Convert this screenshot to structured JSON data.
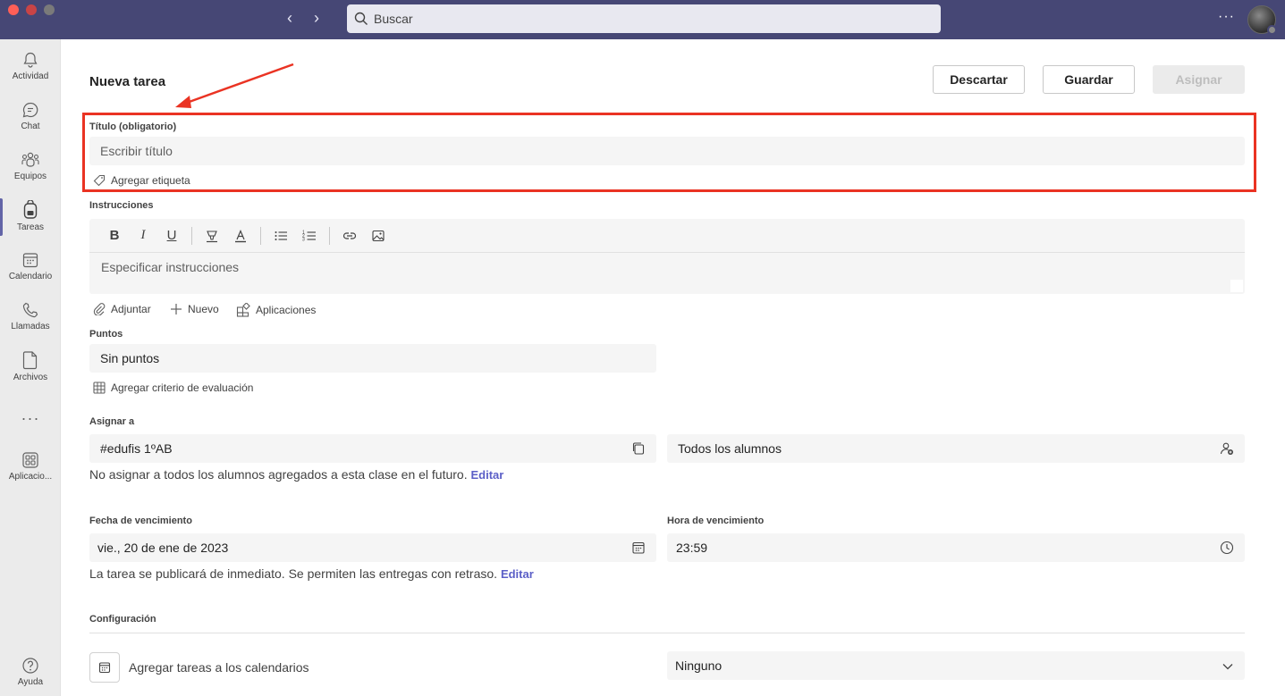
{
  "topbar": {
    "search_placeholder": "Buscar",
    "nav_back": "‹",
    "nav_forward": "›",
    "more": "···"
  },
  "rail": {
    "items": [
      {
        "label": "Actividad",
        "icon": "bell-icon"
      },
      {
        "label": "Chat",
        "icon": "chat-icon"
      },
      {
        "label": "Equipos",
        "icon": "teams-icon"
      },
      {
        "label": "Tareas",
        "icon": "backpack-icon",
        "active": true
      },
      {
        "label": "Calendario",
        "icon": "calendar-icon"
      },
      {
        "label": "Llamadas",
        "icon": "phone-icon"
      },
      {
        "label": "Archivos",
        "icon": "file-icon"
      },
      {
        "label": "Aplicacio...",
        "icon": "apps-icon"
      },
      {
        "label": "Ayuda",
        "icon": "help-icon"
      }
    ],
    "more": "···"
  },
  "header": {
    "title": "Nueva tarea",
    "discard_label": "Descartar",
    "save_label": "Guardar",
    "assign_label": "Asignar"
  },
  "title_field": {
    "label": "Título (obligatorio)",
    "placeholder": "Escribir título",
    "add_tag": "Agregar etiqueta"
  },
  "instructions": {
    "label": "Instrucciones",
    "placeholder": "Especificar instrucciones",
    "toolbar": {
      "bold": "B",
      "italic": "I",
      "underline": "U"
    },
    "attach": "Adjuntar",
    "new": "Nuevo",
    "apps": "Aplicaciones"
  },
  "points": {
    "label": "Puntos",
    "value": "Sin puntos",
    "add_rubric": "Agregar criterio de evaluación"
  },
  "assign_to": {
    "label": "Asignar a",
    "class_value": "#edufis 1ºAB",
    "students_value": "Todos los alumnos",
    "note": "No asignar a todos los alumnos agregados a esta clase en el futuro.",
    "edit": "Editar"
  },
  "due": {
    "date_label": "Fecha de vencimiento",
    "date_value": "vie., 20 de ene de 2023",
    "time_label": "Hora de vencimiento",
    "time_value": "23:59",
    "note": "La tarea se publicará de inmediato. Se permiten las entregas con retraso.",
    "edit": "Editar"
  },
  "settings": {
    "label": "Configuración",
    "calendar_label": "Agregar tareas a los calendarios",
    "calendar_value": "Ninguno"
  },
  "colors": {
    "titlebar": "#464775",
    "accent": "#5b5fc7",
    "annotation": "#ea3323"
  }
}
